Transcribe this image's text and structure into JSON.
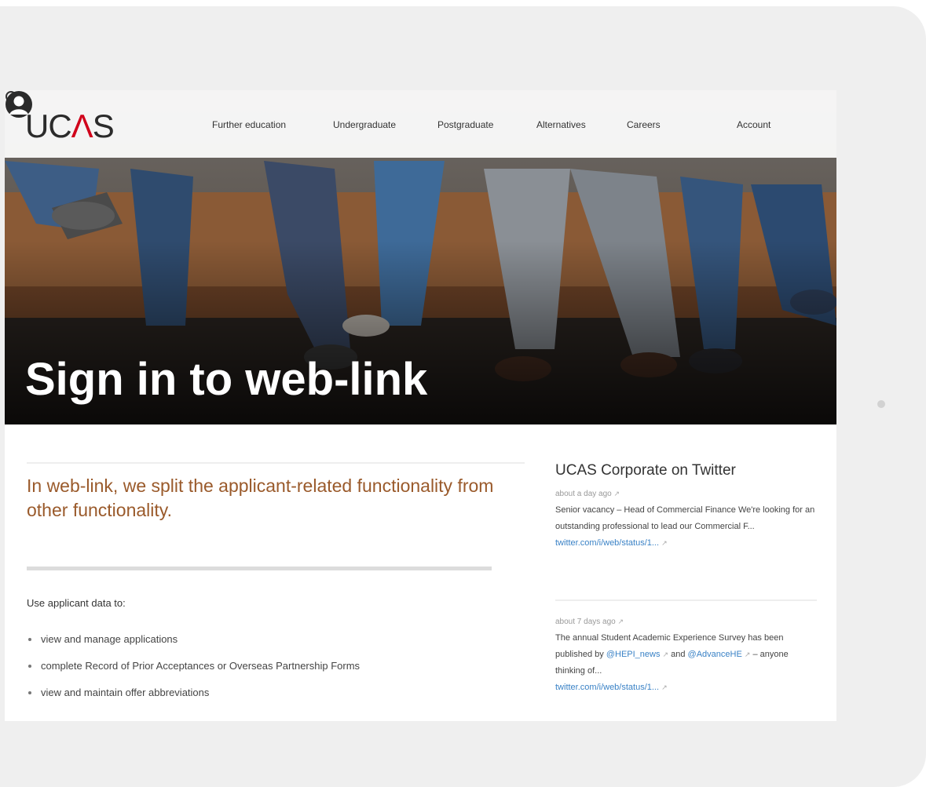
{
  "header": {
    "logo": {
      "before": "UC",
      "mark": "Λ",
      "after": "S"
    },
    "nav": [
      "Further education",
      "Undergraduate",
      "Postgraduate",
      "Alternatives",
      "Careers"
    ],
    "account_label": "Account"
  },
  "hero": {
    "title": "Sign in to web-link"
  },
  "main": {
    "intro": "In web-link, we split the applicant-related functionality from other functionality.",
    "use_label": "Use applicant data to:",
    "bullets": [
      "view and manage applications",
      "complete Record of Prior Acceptances or Overseas Partnership Forms",
      "view and maintain offer abbreviations"
    ]
  },
  "twitter": {
    "title": "UCAS Corporate on Twitter",
    "tweets": [
      {
        "time": "about a day ago",
        "text": "Senior vacancy – Head of Commercial Finance We're looking for an outstanding professional to lead our Commercial F...",
        "link": "twitter.com/i/web/status/1..."
      },
      {
        "time": "about 7 days ago",
        "text_before": "The annual Student Academic Experience Survey has been published by ",
        "mention1": "@HEPI_news",
        "text_mid": " and ",
        "mention2": "@AdvanceHE",
        "text_after": " – anyone thinking of...",
        "link": "twitter.com/i/web/status/1..."
      }
    ]
  },
  "colors": {
    "brand_red": "#d0021b",
    "intro_text": "#9a5a2b",
    "link": "#3a82c6"
  }
}
